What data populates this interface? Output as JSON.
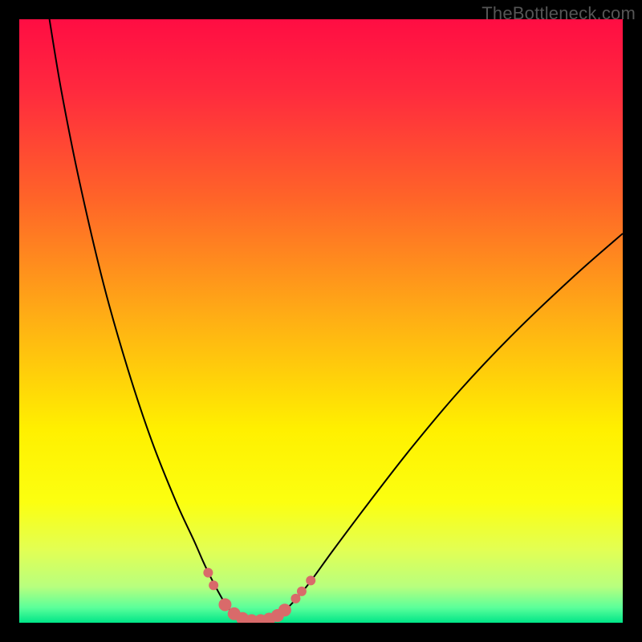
{
  "watermark": "TheBottleneck.com",
  "chart_data": {
    "type": "line",
    "title": "",
    "xlabel": "",
    "ylabel": "",
    "xlim": [
      0,
      100
    ],
    "ylim": [
      0,
      100
    ],
    "gradient_stops": [
      {
        "offset": 0.0,
        "color": "#ff0d43"
      },
      {
        "offset": 0.12,
        "color": "#ff2a3e"
      },
      {
        "offset": 0.3,
        "color": "#ff6528"
      },
      {
        "offset": 0.5,
        "color": "#ffb014"
      },
      {
        "offset": 0.68,
        "color": "#fff000"
      },
      {
        "offset": 0.8,
        "color": "#fcff10"
      },
      {
        "offset": 0.88,
        "color": "#e2ff54"
      },
      {
        "offset": 0.94,
        "color": "#b8ff7e"
      },
      {
        "offset": 0.975,
        "color": "#5bff9a"
      },
      {
        "offset": 1.0,
        "color": "#00e588"
      }
    ],
    "series": [
      {
        "name": "bottleneck-curve",
        "color": "#000000",
        "width": 2.0,
        "points": [
          {
            "x": 5.0,
            "y": 100.0
          },
          {
            "x": 7.0,
            "y": 88.0
          },
          {
            "x": 10.0,
            "y": 73.0
          },
          {
            "x": 14.0,
            "y": 56.0
          },
          {
            "x": 18.0,
            "y": 42.0
          },
          {
            "x": 22.0,
            "y": 30.0
          },
          {
            "x": 26.0,
            "y": 20.0
          },
          {
            "x": 29.0,
            "y": 13.5
          },
          {
            "x": 31.0,
            "y": 9.0
          },
          {
            "x": 33.5,
            "y": 4.2
          },
          {
            "x": 35.0,
            "y": 2.0
          },
          {
            "x": 37.0,
            "y": 0.7
          },
          {
            "x": 39.0,
            "y": 0.3
          },
          {
            "x": 41.0,
            "y": 0.4
          },
          {
            "x": 43.0,
            "y": 1.3
          },
          {
            "x": 45.0,
            "y": 3.0
          },
          {
            "x": 48.0,
            "y": 6.5
          },
          {
            "x": 52.0,
            "y": 12.0
          },
          {
            "x": 58.0,
            "y": 20.0
          },
          {
            "x": 65.0,
            "y": 29.0
          },
          {
            "x": 73.0,
            "y": 38.5
          },
          {
            "x": 82.0,
            "y": 48.0
          },
          {
            "x": 92.0,
            "y": 57.5
          },
          {
            "x": 100.0,
            "y": 64.5
          }
        ]
      }
    ],
    "markers": {
      "name": "highlight-dots",
      "color": "#d96a6a",
      "radius_small": 6,
      "radius_large": 8,
      "points": [
        {
          "x": 31.3,
          "y": 8.3,
          "r": "small"
        },
        {
          "x": 32.2,
          "y": 6.2,
          "r": "small"
        },
        {
          "x": 34.1,
          "y": 3.0,
          "r": "large"
        },
        {
          "x": 35.6,
          "y": 1.5,
          "r": "large"
        },
        {
          "x": 37.0,
          "y": 0.7,
          "r": "large"
        },
        {
          "x": 38.5,
          "y": 0.35,
          "r": "large"
        },
        {
          "x": 40.0,
          "y": 0.35,
          "r": "large"
        },
        {
          "x": 41.4,
          "y": 0.6,
          "r": "large"
        },
        {
          "x": 42.8,
          "y": 1.2,
          "r": "large"
        },
        {
          "x": 44.0,
          "y": 2.1,
          "r": "large"
        },
        {
          "x": 45.8,
          "y": 4.0,
          "r": "small"
        },
        {
          "x": 46.8,
          "y": 5.2,
          "r": "small"
        },
        {
          "x": 48.3,
          "y": 7.0,
          "r": "small"
        }
      ]
    }
  }
}
